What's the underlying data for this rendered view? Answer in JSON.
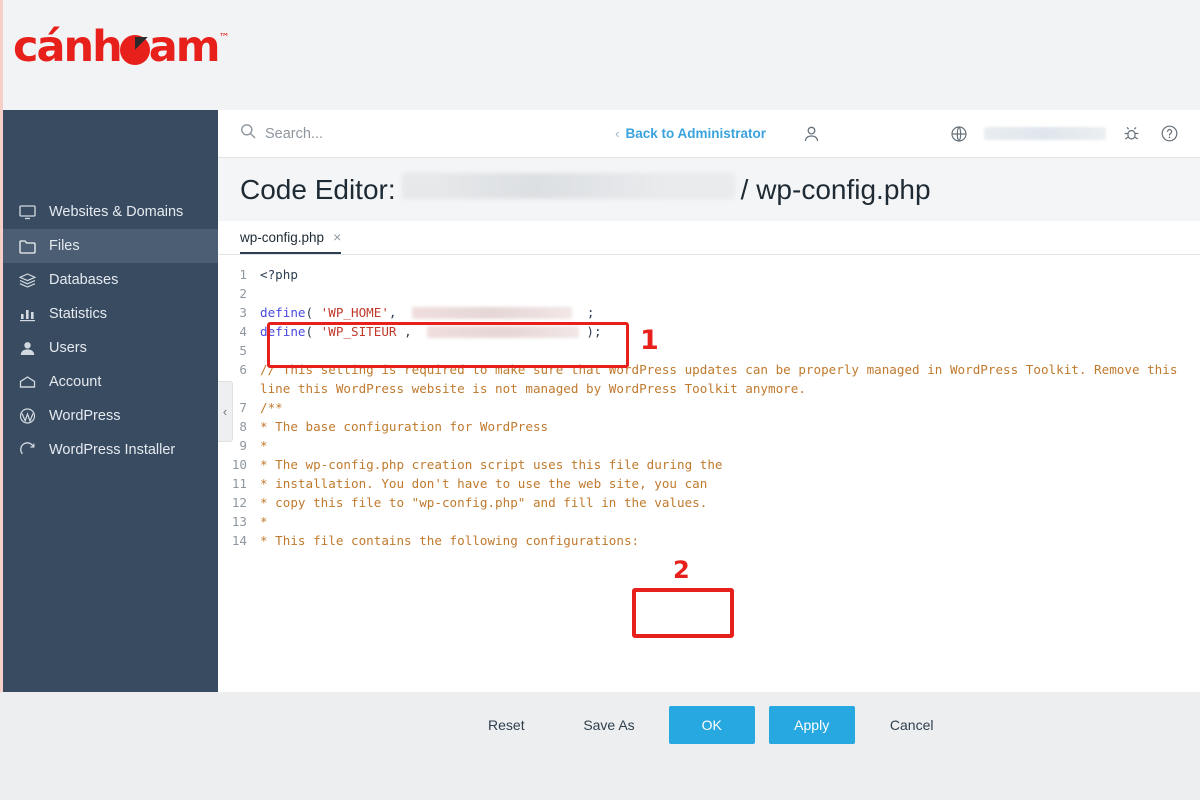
{
  "brand": {
    "name_part1": "c",
    "name_accent": "ánh",
    "name_part2": "am",
    "tm": "™",
    "color": "#e8201c"
  },
  "topbar": {
    "search_placeholder": "Search...",
    "search_icon": "search-icon",
    "back_label": "Back to Administrator",
    "back_chevron": "‹",
    "user_icon": "user-icon",
    "globe_icon": "globe-icon",
    "bug_icon": "bug-icon",
    "help_icon": "help-icon",
    "account_name_redacted": ""
  },
  "sidebar": {
    "items": [
      {
        "label": "Websites & Domains",
        "icon": "monitor-icon",
        "active": false
      },
      {
        "label": "Files",
        "icon": "folder-icon",
        "active": true
      },
      {
        "label": "Databases",
        "icon": "database-icon",
        "active": false
      },
      {
        "label": "Statistics",
        "icon": "bar-chart-icon",
        "active": false
      },
      {
        "label": "Users",
        "icon": "user-icon",
        "active": false
      },
      {
        "label": "Account",
        "icon": "crown-icon",
        "active": false
      },
      {
        "label": "WordPress",
        "icon": "wordpress-icon",
        "active": false
      },
      {
        "label": "WordPress Installer",
        "icon": "installer-icon",
        "active": false
      }
    ],
    "collapse_chevron": "‹"
  },
  "page": {
    "title_prefix": "Code Editor:",
    "title_path_redacted": "",
    "title_suffix": "/ wp-config.php"
  },
  "editor": {
    "tab_label": "wp-config.php",
    "tab_close": "×",
    "lines": [
      {
        "no": "1",
        "kind": "plain",
        "text": "<?php"
      },
      {
        "no": "2",
        "kind": "plain",
        "text": ""
      },
      {
        "no": "3",
        "kind": "define",
        "fn": "define",
        "open": "( ",
        "name": "'WP_HOME'",
        "comma": ",  ",
        "tail": "  ;"
      },
      {
        "no": "4",
        "kind": "define",
        "fn": "define",
        "open": "( ",
        "name": "'WP_SITEUR",
        "comma": " ,  ",
        "tail": " );"
      },
      {
        "no": "5",
        "kind": "plain",
        "text": ""
      },
      {
        "no": "6",
        "kind": "comment-tall",
        "text": "// This setting is required to make sure that WordPress updates can be properly managed in WordPress Toolkit. Remove this line  this WordPress website is not managed by WordPress Toolkit anymore."
      },
      {
        "no": "7",
        "kind": "comment",
        "text": "/**"
      },
      {
        "no": "8",
        "kind": "comment",
        "text": " * The base configuration for WordPress"
      },
      {
        "no": "9",
        "kind": "comment",
        "text": " *"
      },
      {
        "no": "10",
        "kind": "comment",
        "text": " * The wp-config.php creation script uses this file during the"
      },
      {
        "no": "11",
        "kind": "comment",
        "text": " * installation. You don't have to use the web site, you can"
      },
      {
        "no": "12",
        "kind": "comment",
        "text": " * copy this file to \"wp-config.php\" and fill in the values."
      },
      {
        "no": "13",
        "kind": "comment",
        "text": " *"
      },
      {
        "no": "14",
        "kind": "comment",
        "text": " * This file contains the following configurations:"
      }
    ]
  },
  "buttons": [
    {
      "label": "Reset",
      "style": "default"
    },
    {
      "label": "Save As",
      "style": "default"
    },
    {
      "label": "OK",
      "style": "primary"
    },
    {
      "label": "Apply",
      "style": "primary"
    },
    {
      "label": "Cancel",
      "style": "default"
    }
  ],
  "annotations": {
    "marker1": "1",
    "marker2": "2",
    "color": "#e8201c"
  }
}
